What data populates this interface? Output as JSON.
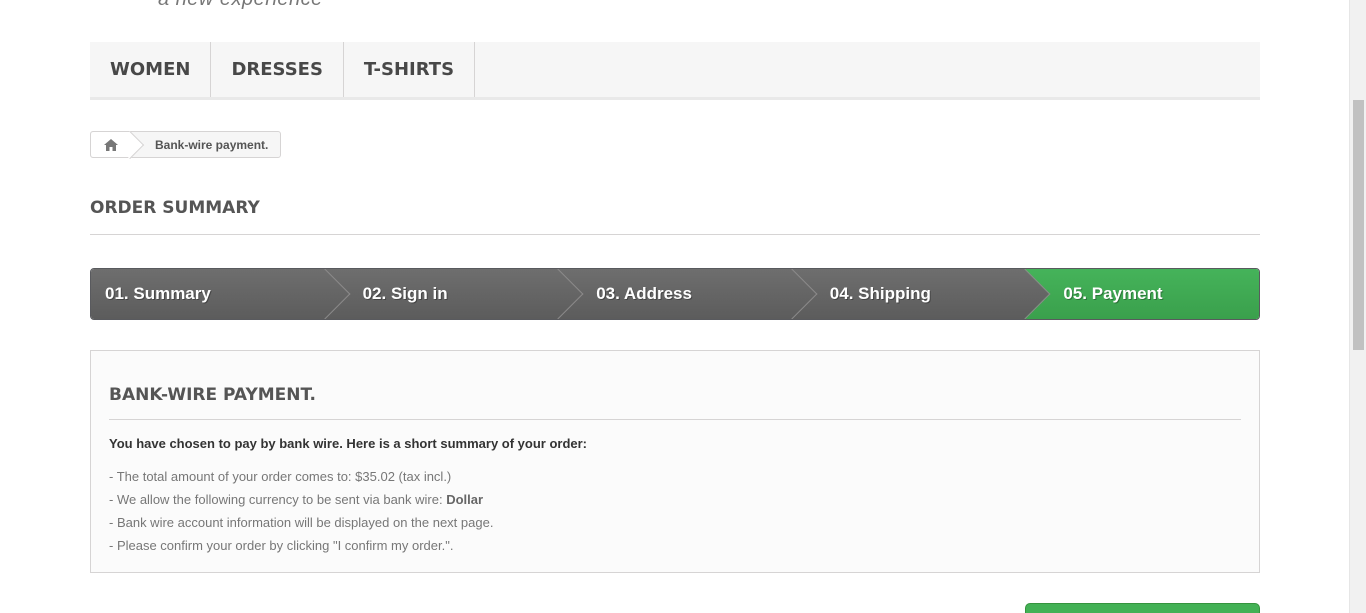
{
  "header": {
    "tagline": "a new experience"
  },
  "menu": {
    "items": [
      {
        "label": "Women"
      },
      {
        "label": "Dresses"
      },
      {
        "label": "T-shirts"
      }
    ]
  },
  "breadcrumb": {
    "home_icon": "home-icon",
    "current": "Bank-wire payment."
  },
  "page_heading": "Order summary",
  "steps": [
    {
      "label": "01. Summary",
      "active": false
    },
    {
      "label": "02. Sign in",
      "active": false
    },
    {
      "label": "03. Address",
      "active": false
    },
    {
      "label": "04. Shipping",
      "active": false
    },
    {
      "label": "05. Payment",
      "active": true
    }
  ],
  "payment_box": {
    "title": "Bank-wire payment.",
    "intro": "You have chosen to pay by bank wire. Here is a short summary of your order:",
    "line_total_prefix": "- The total amount of your order comes to: ",
    "line_total_amount": "$35.02",
    "line_total_suffix": " (tax incl.)",
    "line_currency_prefix": "- We allow the following currency to be sent via bank wire: ",
    "line_currency_value": "Dollar",
    "line_account": "- Bank wire account information will be displayed on the next page.",
    "line_confirm": "- Please confirm your order by clicking \"I confirm my order.\"."
  },
  "colors": {
    "step_active": "#45b35a",
    "step_inactive": "#666666",
    "confirm_button": "#43b155"
  }
}
